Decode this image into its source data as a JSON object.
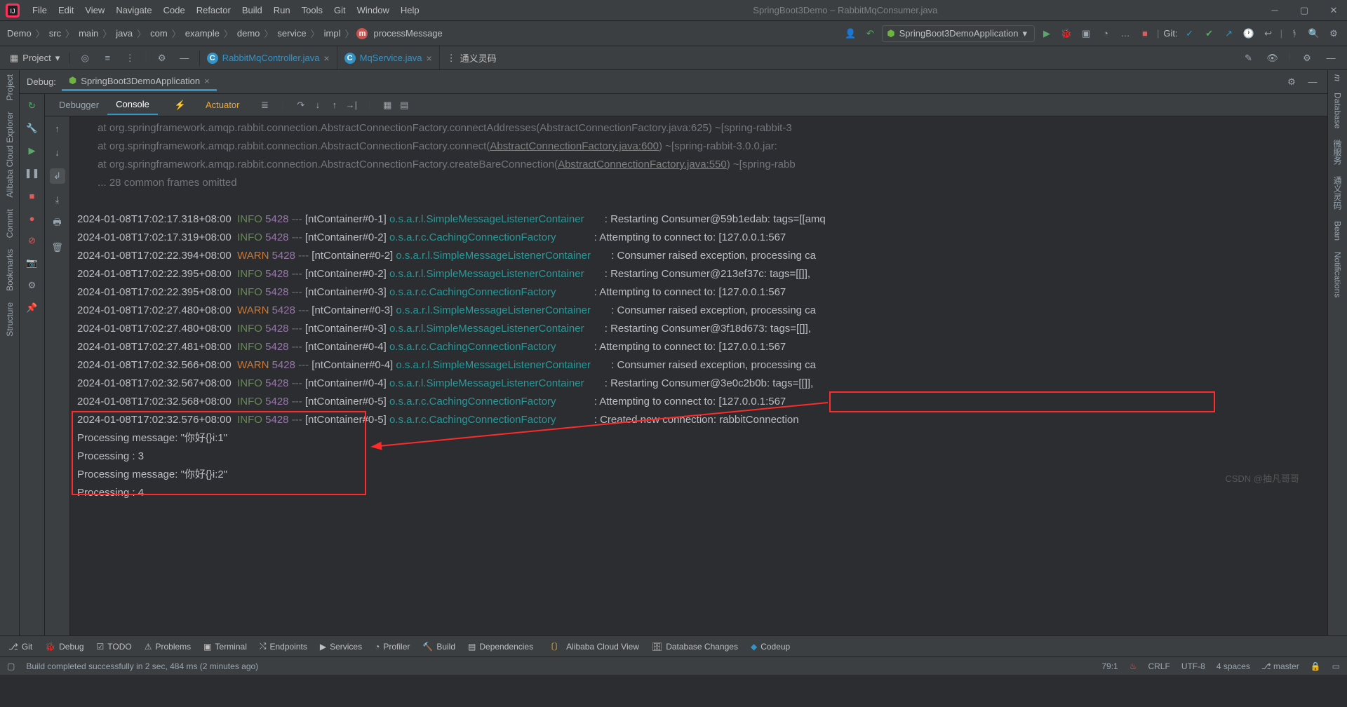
{
  "window": {
    "title": "SpringBoot3Demo – RabbitMqConsumer.java"
  },
  "menu": [
    "File",
    "Edit",
    "View",
    "Navigate",
    "Code",
    "Refactor",
    "Build",
    "Run",
    "Tools",
    "Git",
    "Window",
    "Help"
  ],
  "crumbs": [
    "Demo",
    "src",
    "main",
    "java",
    "com",
    "example",
    "demo",
    "service",
    "impl"
  ],
  "crumb_method": "processMessage",
  "run_config": "SpringBoot3DemoApplication",
  "git_label": "Git:",
  "project_btn": "Project",
  "tabs": [
    {
      "name": "RabbitMqController.java"
    },
    {
      "name": "MqService.java"
    }
  ],
  "tab_extra": "通义灵码",
  "left_tools": [
    "Project",
    "Alibaba Cloud Explorer",
    "Commit",
    "Bookmarks",
    "Structure"
  ],
  "right_tools": [
    "Maven",
    "Database",
    "微服务",
    "通义灵码",
    "Bean",
    "Notifications"
  ],
  "debug_label": "Debug:",
  "debug_tab": "SpringBoot3DemoApplication",
  "panel_tabs": {
    "debugger": "Debugger",
    "console": "Console",
    "actuator": "Actuator"
  },
  "console_top": [
    "       at org.springframework.amqp.rabbit.connection.AbstractConnectionFactory.connectAddresses(AbstractConnectionFactory.java:625) ~[spring-rabbit-3",
    {
      "pre": "       at org.springframework.amqp.rabbit.connection.AbstractConnectionFactory.connect(",
      "link": "AbstractConnectionFactory.java:600",
      "post": ") ~[spring-rabbit-3.0.0.jar:"
    },
    {
      "pre": "       at org.springframework.amqp.rabbit.connection.AbstractConnectionFactory.createBareConnection(",
      "link": "AbstractConnectionFactory.java:550",
      "post": ") ~[spring-rabb"
    },
    "       ... 28 common frames omitted"
  ],
  "log": [
    {
      "ts": "2024-01-08T17:02:17.318+08:00",
      "lvl": "INFO",
      "pid": "5428",
      "thr": "[ntContainer#0-1]",
      "lg": "o.s.a.r.l.SimpleMessageListenerContainer",
      "msg": ": Restarting Consumer@59b1edab: tags=[[amq"
    },
    {
      "ts": "2024-01-08T17:02:17.319+08:00",
      "lvl": "INFO",
      "pid": "5428",
      "thr": "[ntContainer#0-2]",
      "lg": "o.s.a.r.c.CachingConnectionFactory",
      "msg": ": Attempting to connect to: [127.0.0.1:567"
    },
    {
      "ts": "2024-01-08T17:02:22.394+08:00",
      "lvl": "WARN",
      "pid": "5428",
      "thr": "[ntContainer#0-2]",
      "lg": "o.s.a.r.l.SimpleMessageListenerContainer",
      "msg": ": Consumer raised exception, processing ca"
    },
    {
      "ts": "2024-01-08T17:02:22.395+08:00",
      "lvl": "INFO",
      "pid": "5428",
      "thr": "[ntContainer#0-2]",
      "lg": "o.s.a.r.l.SimpleMessageListenerContainer",
      "msg": ": Restarting Consumer@213ef37c: tags=[[]],"
    },
    {
      "ts": "2024-01-08T17:02:22.395+08:00",
      "lvl": "INFO",
      "pid": "5428",
      "thr": "[ntContainer#0-3]",
      "lg": "o.s.a.r.c.CachingConnectionFactory",
      "msg": ": Attempting to connect to: [127.0.0.1:567"
    },
    {
      "ts": "2024-01-08T17:02:27.480+08:00",
      "lvl": "WARN",
      "pid": "5428",
      "thr": "[ntContainer#0-3]",
      "lg": "o.s.a.r.l.SimpleMessageListenerContainer",
      "msg": ": Consumer raised exception, processing ca"
    },
    {
      "ts": "2024-01-08T17:02:27.480+08:00",
      "lvl": "INFO",
      "pid": "5428",
      "thr": "[ntContainer#0-3]",
      "lg": "o.s.a.r.l.SimpleMessageListenerContainer",
      "msg": ": Restarting Consumer@3f18d673: tags=[[]],"
    },
    {
      "ts": "2024-01-08T17:02:27.481+08:00",
      "lvl": "INFO",
      "pid": "5428",
      "thr": "[ntContainer#0-4]",
      "lg": "o.s.a.r.c.CachingConnectionFactory",
      "msg": ": Attempting to connect to: [127.0.0.1:567"
    },
    {
      "ts": "2024-01-08T17:02:32.566+08:00",
      "lvl": "WARN",
      "pid": "5428",
      "thr": "[ntContainer#0-4]",
      "lg": "o.s.a.r.l.SimpleMessageListenerContainer",
      "msg": ": Consumer raised exception, processing ca"
    },
    {
      "ts": "2024-01-08T17:02:32.567+08:00",
      "lvl": "INFO",
      "pid": "5428",
      "thr": "[ntContainer#0-4]",
      "lg": "o.s.a.r.l.SimpleMessageListenerContainer",
      "msg": ": Restarting Consumer@3e0c2b0b: tags=[[]],"
    },
    {
      "ts": "2024-01-08T17:02:32.568+08:00",
      "lvl": "INFO",
      "pid": "5428",
      "thr": "[ntContainer#0-5]",
      "lg": "o.s.a.r.c.CachingConnectionFactory",
      "msg": ": Attempting to connect to: [127.0.0.1:567"
    },
    {
      "ts": "2024-01-08T17:02:32.576+08:00",
      "lvl": "INFO",
      "pid": "5428",
      "thr": "[ntContainer#0-5]",
      "lg": "o.s.a.r.c.CachingConnectionFactory",
      "msg": ": Created new connection: rabbitConnection"
    }
  ],
  "out": [
    "Processing message: \"你好{}i:1\"",
    "Processing : 3",
    "Processing message: \"你好{}i:2\"",
    "Processing : 4"
  ],
  "watermark": "CSDN @抽凡哥哥",
  "bottom": {
    "git": "Git",
    "debug": "Debug",
    "todo": "TODO",
    "problems": "Problems",
    "terminal": "Terminal",
    "endpoints": "Endpoints",
    "services": "Services",
    "profiler": "Profiler",
    "build": "Build",
    "dependencies": "Dependencies",
    "alibaba": "Alibaba Cloud View",
    "dbchanges": "Database Changes",
    "codeup": "Codeup"
  },
  "status": {
    "msg": "Build completed successfully in 2 sec, 484 ms (2 minutes ago)",
    "pos": "79:1",
    "lf": "CRLF",
    "enc": "UTF-8",
    "indent": "4 spaces",
    "branch": "master"
  }
}
